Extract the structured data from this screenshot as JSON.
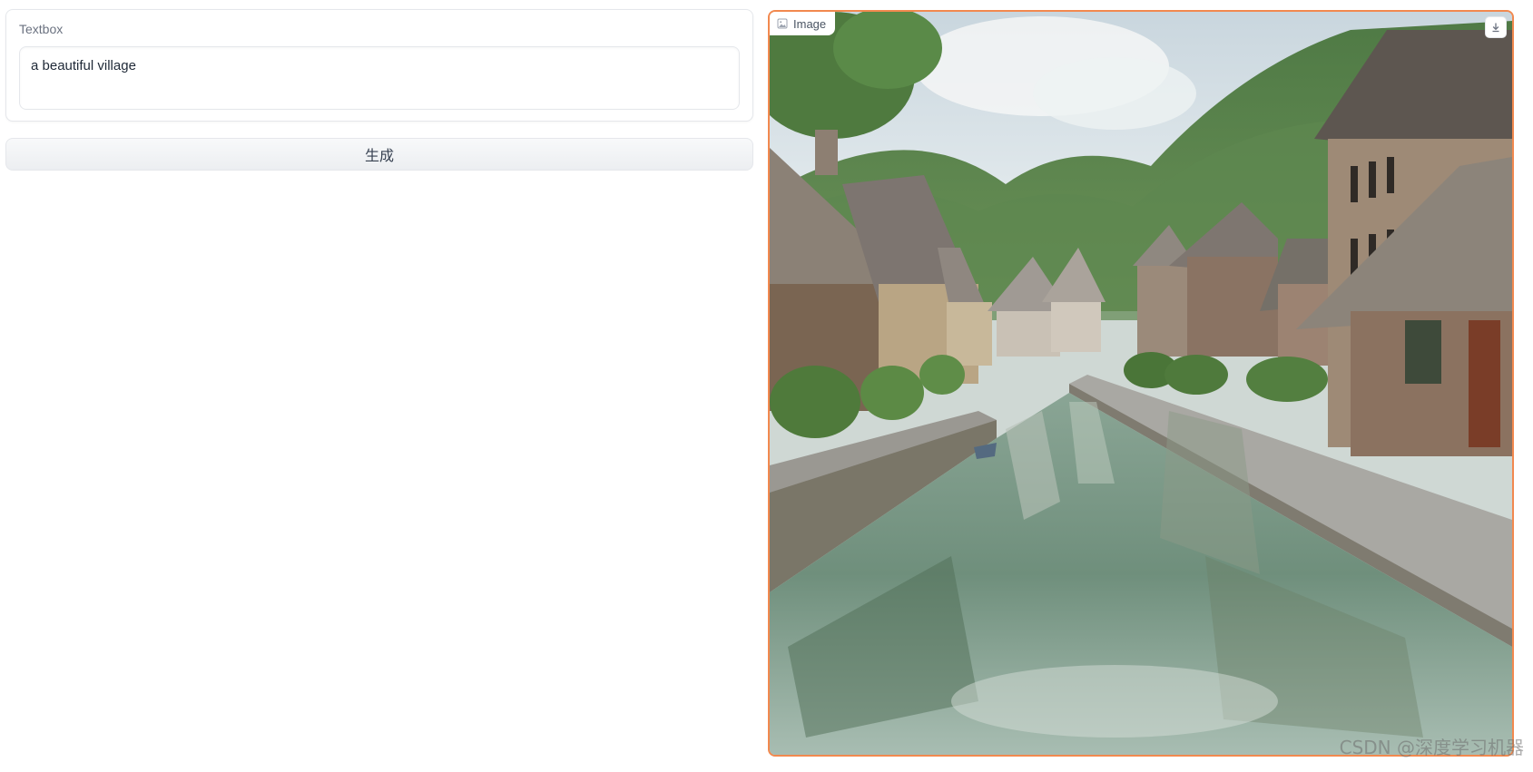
{
  "textbox": {
    "label": "Textbox",
    "value": "a beautiful village"
  },
  "generate_button": {
    "label": "生成"
  },
  "image_output": {
    "label": "Image",
    "icon": "image-icon",
    "download_icon": "download-icon",
    "border_color": "#f2894f"
  },
  "watermark": {
    "text": "CSDN @深度学习机器"
  }
}
